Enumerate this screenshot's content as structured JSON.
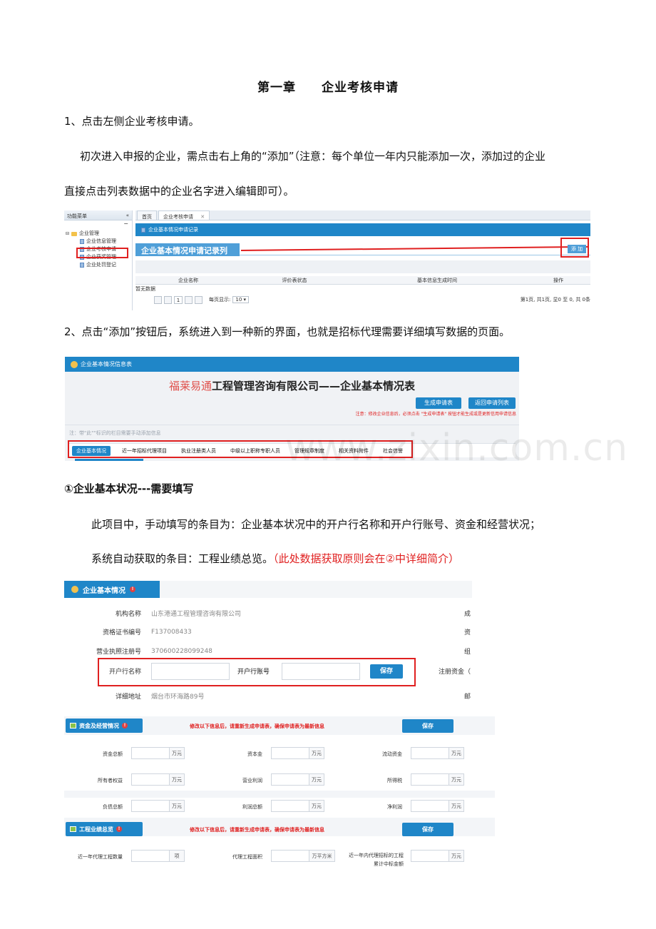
{
  "heading": {
    "chapter": "第一章",
    "title": "企业考核申请"
  },
  "step1": "1、点击左侧企业考核申请。",
  "para1_line1": "初次进入申报的企业，需点击右上角的“添加”（注意：每个单位一年内只能添加一次，添加过的企业",
  "para1_line2": "直接点击列表数据中的企业名字进入编辑即可）。",
  "shot1": {
    "sidebar_title": "功能菜单",
    "collapse": "«",
    "minus": "−",
    "tree_root": "企业管理",
    "tree_items": [
      "企业信息管理",
      "企业考核申请",
      "企业获奖管理",
      "企业处罚登记"
    ],
    "tabs": [
      "首页",
      "企业考核申请"
    ],
    "tab_close": "✕",
    "bar_title": "企业基本情况申请记录",
    "list_title": "企业基本情况申请记录列表",
    "add_button": "添 加",
    "columns": [
      "企业名称",
      "评价表状态",
      "基本信息生成时间",
      "操作"
    ],
    "empty": "暂无数据",
    "page_value": "1",
    "per_page_label": "每页显示:",
    "per_page_value": "10",
    "page_info": "第1页, 共1页, 显0 至 0, 共 0条"
  },
  "step2": "2、点击“添加”按钮后，系统进入到一种新的界面，也就是招标代理需要详细填写数据的页面。",
  "shot2": {
    "header": "企业基本情况信息表",
    "brand": "福莱易通",
    "title": "工程管理咨询有限公司——企业基本情况表",
    "btn_generate": "生成申请表",
    "btn_back": "返回申请列表",
    "note": "注意：修改企业信息后，必须点击 \"生成申请表\" 按钮才能生成或是更新信用申请信息",
    "hint": "注：带\"此\"\"标识的栏目需要手动添加信息",
    "tabs": [
      "企业基本情况",
      "近一年招标代理项目",
      "执业注册类人员",
      "中级以上职称专职人员",
      "管理规章制度",
      "相关资料附件",
      "社会信誉"
    ]
  },
  "watermark": "www.zixin.com.cn",
  "section1_title": "①企业基本状况---需要填写",
  "para2": "此项目中，手动填写的条目为：企业基本状况中的开户行名称和开户行账号、资金和经营状况；",
  "para3_a": "系统自动获取的条目：工程业绩总览。",
  "para3_b": "（此处数据获取原则会在②中详细简介）",
  "shot3": {
    "tab": "企业基本情况",
    "badge": "!",
    "rows": [
      {
        "label": "机构名称",
        "value": "山东港通工程管理咨询有限公司",
        "edge": "成"
      },
      {
        "label": "资格证书编号",
        "value": "F137008433",
        "edge": "资"
      },
      {
        "label": "营业执照注册号",
        "value": "370600228099248",
        "edge": "组"
      },
      {
        "label": "详细地址",
        "value": "烟台市环海路89号",
        "edge": "邮"
      }
    ],
    "bank_name_label": "开户行名称",
    "bank_account_label": "开户行账号",
    "save": "保存",
    "reg_capital": "注册资金（"
  },
  "shot4": {
    "sec1_tab": "资金及经营情况",
    "sec2_tab": "工程业绩总览",
    "badge": "!",
    "warn": "修改以下信息后，请重新生成申请表，确保申请表为最新信息",
    "save": "保存",
    "fin_rows": [
      [
        {
          "label": "资金总额",
          "unit": "万元"
        },
        {
          "label": "资本金",
          "unit": "万元"
        },
        {
          "label": "流动资金",
          "unit": "万元"
        }
      ],
      [
        {
          "label": "所有者权益",
          "unit": "万元"
        },
        {
          "label": "营业利润",
          "unit": "万元"
        },
        {
          "label": "所得税",
          "unit": "万元"
        }
      ],
      [
        {
          "label": "负债总额",
          "unit": "万元"
        },
        {
          "label": "利润总额",
          "unit": "万元"
        },
        {
          "label": "净利润",
          "unit": "万元"
        }
      ]
    ],
    "perf": [
      {
        "label": "近一年代理工程数量",
        "unit": "项"
      },
      {
        "label": "代理工程面积",
        "unit": "万平方米"
      },
      {
        "label": "近一年内代理招标的工程累计中标金额",
        "unit": "万元"
      }
    ]
  }
}
